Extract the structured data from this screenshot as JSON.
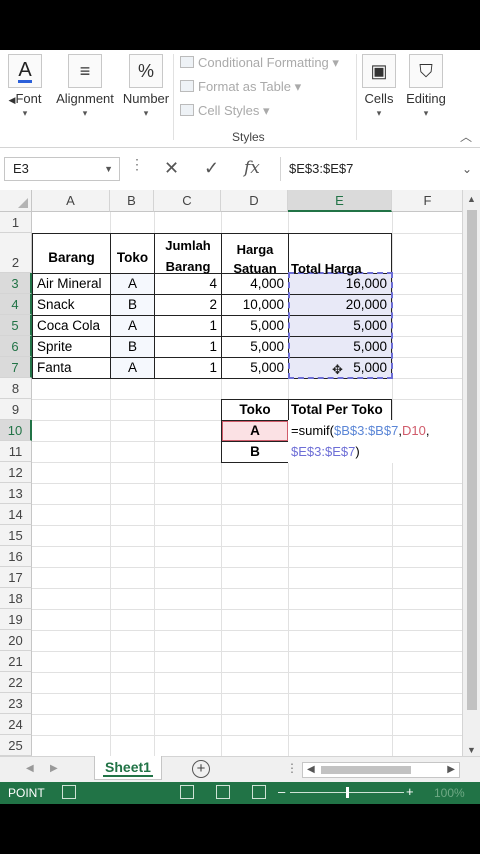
{
  "ribbon": {
    "font_label": "Font",
    "alignment_label": "Alignment",
    "number_label": "Number",
    "conditional_formatting": "Conditional Formatting",
    "format_as_table": "Format as Table",
    "cell_styles": "Cell Styles",
    "styles_group_label": "Styles",
    "cells_label": "Cells",
    "editing_label": "Editing",
    "font_icon": "A",
    "number_icon": "%"
  },
  "formula_bar": {
    "name_box": "E3",
    "fx": "fx",
    "formula": "$E$3:$E$7"
  },
  "columns": [
    "A",
    "B",
    "C",
    "D",
    "E",
    "F"
  ],
  "rows": [
    "1",
    "2",
    "3",
    "4",
    "5",
    "6",
    "7",
    "8",
    "9",
    "10",
    "11",
    "12",
    "13",
    "14",
    "15",
    "16",
    "17",
    "18",
    "19",
    "20",
    "21",
    "22",
    "23",
    "24",
    "25"
  ],
  "table": {
    "headers": {
      "barang": "Barang",
      "toko": "Toko",
      "jumlah_1": "Jumlah",
      "jumlah_2": "Barang",
      "harga_1": "Harga",
      "harga_2": "Satuan",
      "total": "Total Harga"
    },
    "rows": [
      {
        "barang": "Air Mineral",
        "toko": "A",
        "jumlah": "4",
        "harga": "4,000",
        "total": "16,000"
      },
      {
        "barang": "Snack",
        "toko": "B",
        "jumlah": "2",
        "harga": "10,000",
        "total": "20,000"
      },
      {
        "barang": "Coca Cola",
        "toko": "A",
        "jumlah": "1",
        "harga": "5,000",
        "total": "5,000"
      },
      {
        "barang": "Sprite",
        "toko": "B",
        "jumlah": "1",
        "harga": "5,000",
        "total": "5,000"
      },
      {
        "barang": "Fanta",
        "toko": "A",
        "jumlah": "1",
        "harga": "5,000",
        "total": "5,000"
      }
    ]
  },
  "summary": {
    "header_toko": "Toko",
    "header_total": "Total Per Toko",
    "toko_a": "A",
    "toko_b": "B",
    "formula_prefix": "=sumif(",
    "formula_ref1": "$B$3:$B$7",
    "formula_comma1": ",",
    "formula_ref2": "D10",
    "formula_comma2": ",",
    "formula_ref3": "$E$3:$E$7",
    "formula_suffix": ")"
  },
  "sheet_tab": "Sheet1",
  "status": {
    "mode": "POINT",
    "zoom": "100%"
  },
  "colors": {
    "excel_green": "#217346",
    "ref_blue": "#5b86d6",
    "ref_red": "#d05b6a",
    "ref_purple": "#6d6ed6"
  }
}
